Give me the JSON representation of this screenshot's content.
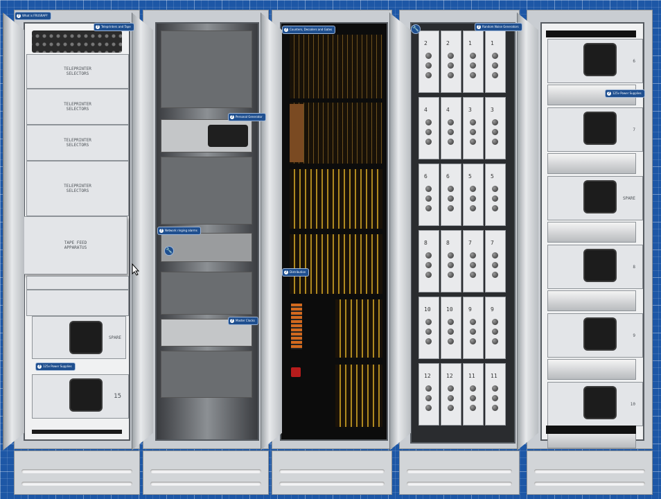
{
  "tags": {
    "what_is": "What is FRUSRAP?",
    "teleprinters": "Teleprinters and Tape",
    "personal_gen": "Personal Generator",
    "ringing": "Network ringing alarms",
    "master_clock": "Master Clocks",
    "counters": "Counters, Decoders and Gates",
    "distribution": "Distribution",
    "random_num": "Random Noise Generators",
    "psu_a": "125v Power Supplies",
    "psu_b": "125v Power Supplies"
  },
  "cabinet1": {
    "selectors": [
      "TELEPRINTER\nSELECTORS",
      "TELEPRINTER\nSELECTORS",
      "TELEPRINTER\nSELECTORS",
      "TELEPRINTER\nSELECTORS"
    ],
    "tape_feed": "TAPE FEED\nAPPARATUS",
    "spare": "SPARE",
    "psu_number": "15"
  },
  "cabinet4": {
    "rows": [
      [
        "2",
        "2",
        "1",
        "1"
      ],
      [
        "4",
        "4",
        "3",
        "3"
      ],
      [
        "6",
        "6",
        "5",
        "5"
      ],
      [
        "8",
        "8",
        "7",
        "7"
      ],
      [
        "10",
        "10",
        "9",
        "9"
      ],
      [
        "12",
        "12",
        "11",
        "11"
      ]
    ]
  },
  "cabinet5": {
    "psus": [
      "6",
      "7",
      "SPARE",
      "8",
      "9",
      "10"
    ]
  },
  "icons": {
    "tag_icon": "question-icon",
    "wrench": "wrench-icon",
    "cursor": "mouse-cursor-icon"
  }
}
